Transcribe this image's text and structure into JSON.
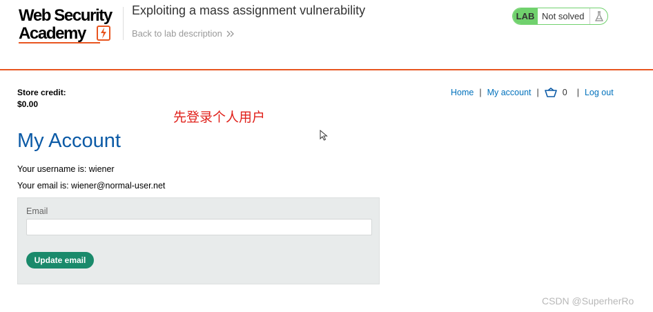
{
  "header": {
    "logo_line1": "Web Security",
    "logo_line2": "Academy",
    "lab_title": "Exploiting a mass assignment vulnerability",
    "back_link": "Back to lab description",
    "back_link_icon": "double-chevron-right-icon",
    "lab_badge": "LAB",
    "lab_status": "Not solved",
    "flask_icon": "flask-icon"
  },
  "store_credit": {
    "label": "Store credit:",
    "value": "$0.00"
  },
  "nav": {
    "home": "Home",
    "separator": "|",
    "my_account": "My account",
    "cart_icon": "cart-icon",
    "cart_count": "0",
    "log_out": "Log out"
  },
  "annotation": "先登录个人用户",
  "account": {
    "title": "My Account",
    "username_line": "Your username is: wiener",
    "email_line": "Your email is: wiener@normal-user.net"
  },
  "form": {
    "email_label": "Email",
    "email_value": "",
    "update_button": "Update email"
  },
  "watermark": "CSDN @SuperherRo",
  "colors": {
    "accent_orange": "#e8541e",
    "link_blue": "#0071bc",
    "title_blue": "#0b5aa6",
    "lab_green": "#70d16d",
    "button_green": "#1a8a6b",
    "annotation_red": "#e0201a"
  }
}
